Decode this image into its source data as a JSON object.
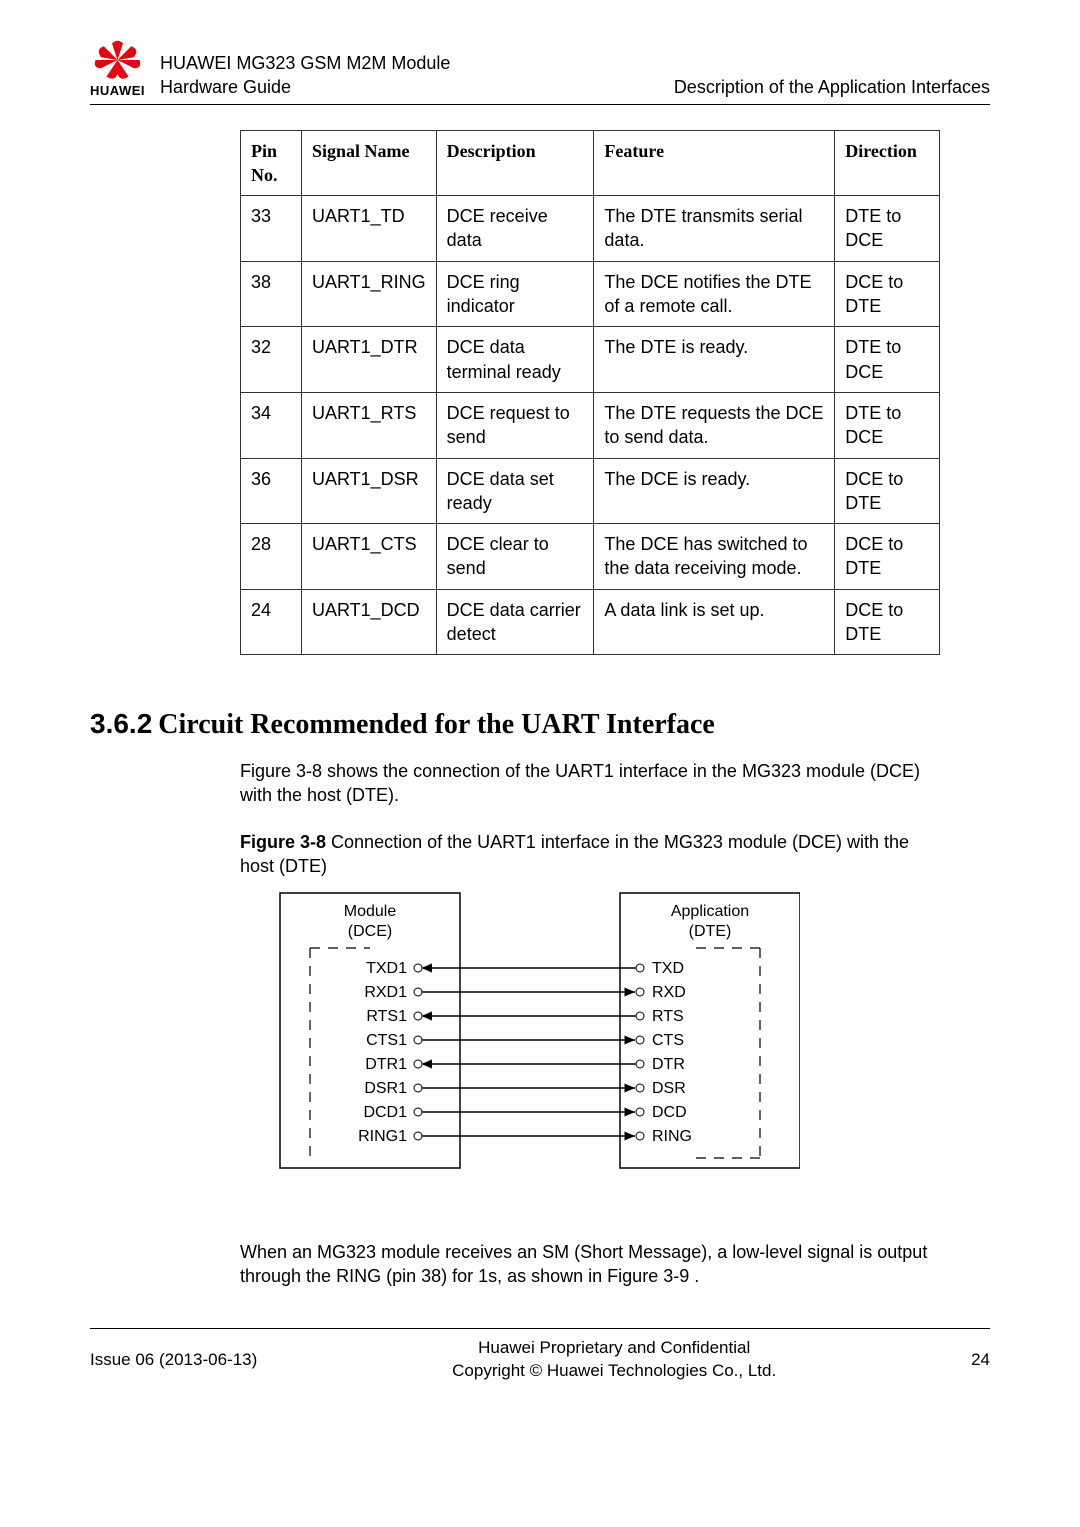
{
  "header": {
    "brand": "HUAWEI",
    "title_line1": "HUAWEI MG323 GSM M2M Module",
    "title_line2": "Hardware Guide",
    "right": "Description of the Application Interfaces"
  },
  "table": {
    "headers": [
      "Pin No.",
      "Signal Name",
      "Description",
      "Feature",
      "Direction"
    ],
    "rows": [
      {
        "pin": "33",
        "signal": "UART1_TD",
        "desc": "DCE receive data",
        "feature": "The DTE transmits serial data.",
        "dir": "DTE to DCE"
      },
      {
        "pin": "38",
        "signal": "UART1_RING",
        "desc": "DCE ring indicator",
        "feature": "The DCE notifies the DTE of a remote call.",
        "dir": "DCE to DTE"
      },
      {
        "pin": "32",
        "signal": "UART1_DTR",
        "desc": "DCE data terminal ready",
        "feature": "The DTE is ready.",
        "dir": "DTE to DCE"
      },
      {
        "pin": "34",
        "signal": "UART1_RTS",
        "desc": "DCE request to send",
        "feature": "The DTE requests the DCE to send data.",
        "dir": "DTE to DCE"
      },
      {
        "pin": "36",
        "signal": "UART1_DSR",
        "desc": "DCE data set ready",
        "feature": "The DCE is ready.",
        "dir": "DCE to DTE"
      },
      {
        "pin": "28",
        "signal": "UART1_CTS",
        "desc": "DCE clear to send",
        "feature": "The DCE has switched to the data receiving mode.",
        "dir": "DCE to DTE"
      },
      {
        "pin": "24",
        "signal": "UART1_DCD",
        "desc": "DCE data carrier detect",
        "feature": "A data link is set up.",
        "dir": "DCE to DTE"
      }
    ]
  },
  "section": {
    "number": "3.6.2",
    "title": "Circuit Recommended for the UART Interface",
    "para1": "Figure 3-8 shows the connection of the UART1 interface in the MG323 module (DCE) with the host (DTE).",
    "fig_label": "Figure 3-8",
    "fig_text": " Connection of the UART1 interface in the MG323 module (DCE) with the host (DTE)",
    "para2": "When an MG323 module receives an SM (Short Message), a low-level signal is output through the RING (pin 38) for 1s, as shown in Figure 3-9 ."
  },
  "diagram": {
    "left_block_l1": "Module",
    "left_block_l2": "(DCE)",
    "right_block_l1": "Application",
    "right_block_l2": "(DTE)",
    "pairs": [
      {
        "left": "TXD1",
        "right": "TXD",
        "arrow": "to_left"
      },
      {
        "left": "RXD1",
        "right": "RXD",
        "arrow": "to_right"
      },
      {
        "left": "RTS1",
        "right": "RTS",
        "arrow": "to_left"
      },
      {
        "left": "CTS1",
        "right": "CTS",
        "arrow": "to_right"
      },
      {
        "left": "DTR1",
        "right": "DTR",
        "arrow": "to_left"
      },
      {
        "left": "DSR1",
        "right": "DSR",
        "arrow": "to_right"
      },
      {
        "left": "DCD1",
        "right": "DCD",
        "arrow": "to_right"
      },
      {
        "left": "RING1",
        "right": "RING",
        "arrow": "to_right"
      }
    ]
  },
  "footer": {
    "left": "Issue 06 (2013-06-13)",
    "center_l1": "Huawei Proprietary and Confidential",
    "center_l2": "Copyright © Huawei Technologies Co., Ltd.",
    "right": "24"
  }
}
